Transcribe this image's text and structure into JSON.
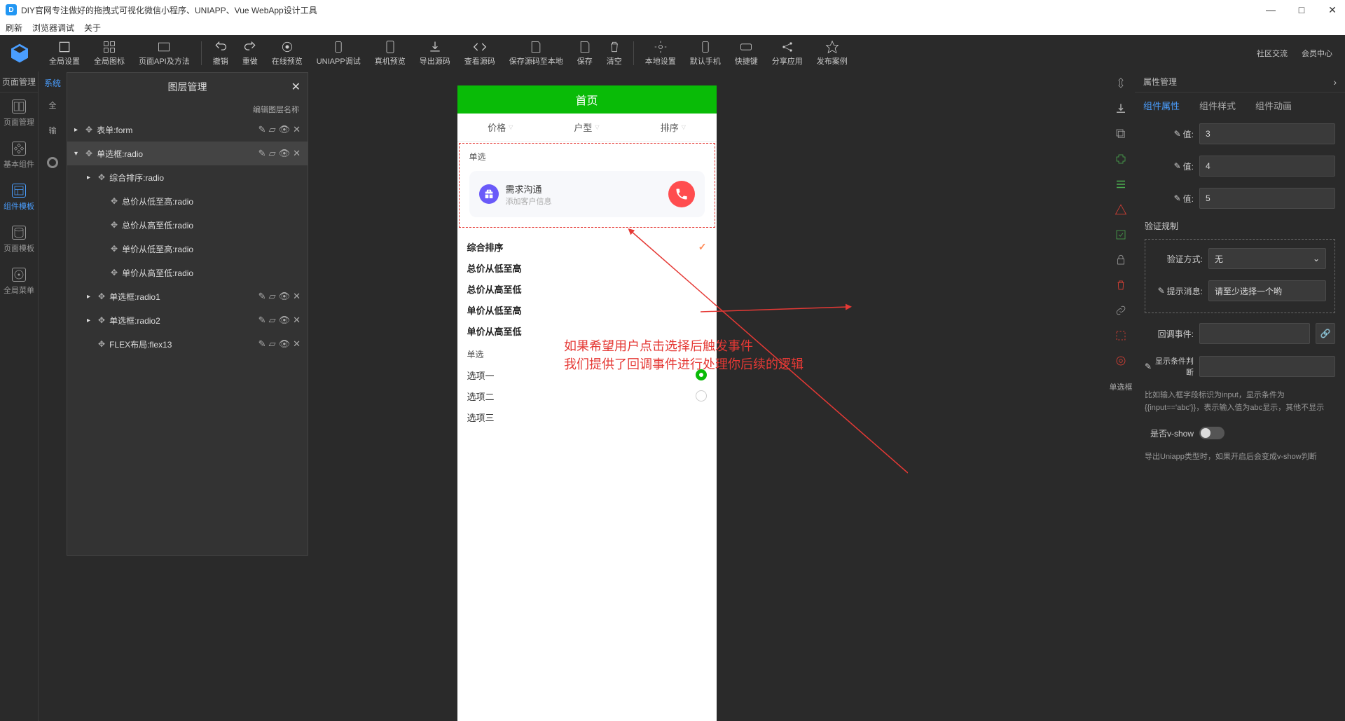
{
  "window": {
    "title": "DIY官网专注做好的拖拽式可视化微信小程序、UNIAPP、Vue WebApp设计工具"
  },
  "menubar": [
    "刷新",
    "浏览器调试",
    "关于"
  ],
  "toolbar": [
    {
      "label": "全局设置"
    },
    {
      "label": "全局图标"
    },
    {
      "label": "页面API及方法"
    },
    {
      "label": "撤销"
    },
    {
      "label": "重做"
    },
    {
      "label": "在线预览"
    },
    {
      "label": "UNIAPP调试"
    },
    {
      "label": "真机预览"
    },
    {
      "label": "导出源码"
    },
    {
      "label": "查看源码"
    },
    {
      "label": "保存源码至本地"
    },
    {
      "label": "保存"
    },
    {
      "label": "清空"
    },
    {
      "label": "本地设置"
    },
    {
      "label": "默认手机"
    },
    {
      "label": "快捷键"
    },
    {
      "label": "分享应用"
    },
    {
      "label": "发布案例"
    },
    {
      "label": "社区交流"
    },
    {
      "label": "会员中心"
    }
  ],
  "leftrail": {
    "pagetab": "页面管理",
    "items": [
      "页面管理",
      "基本组件",
      "组件模板",
      "页面模板",
      "全局菜单"
    ]
  },
  "syslabel": "系统",
  "sysitems": [
    "全",
    "输"
  ],
  "layer": {
    "title": "图层管理",
    "sub": "编辑图层名称",
    "items": [
      {
        "lv": 1,
        "arrow": "▸",
        "name": "表单:form",
        "ops": true
      },
      {
        "lv": 1,
        "arrow": "▾",
        "name": "单选框:radio",
        "ops": true,
        "active": true
      },
      {
        "lv": 2,
        "arrow": "▸",
        "name": "综合排序:radio"
      },
      {
        "lv": 3,
        "arrow": "",
        "name": "总价从低至高:radio"
      },
      {
        "lv": 3,
        "arrow": "",
        "name": "总价从高至低:radio"
      },
      {
        "lv": 3,
        "arrow": "",
        "name": "单价从低至高:radio"
      },
      {
        "lv": 3,
        "arrow": "",
        "name": "单价从高至低:radio"
      },
      {
        "lv": 2,
        "arrow": "▸",
        "name": "单选框:radio1",
        "ops": true
      },
      {
        "lv": 2,
        "arrow": "▸",
        "name": "单选框:radio2",
        "ops": true
      },
      {
        "lv": 2,
        "arrow": "",
        "name": "FLEX布局:flex13",
        "ops": true
      }
    ]
  },
  "phone": {
    "title": "首页",
    "tabs": [
      "价格",
      "户型",
      "排序"
    ],
    "sec1": "单选",
    "card": {
      "t1": "需求沟通",
      "t2": "添加客户信息"
    },
    "sortlist": [
      "综合排序",
      "总价从低至高",
      "总价从高至低",
      "单价从低至高",
      "单价从高至低"
    ],
    "sec2": "单选",
    "opts": [
      "选项一",
      "选项二",
      "选项三"
    ]
  },
  "annotation": {
    "l1": "如果希望用户点击选择后触发事件",
    "l2": "我们提供了回调事件进行处理你后续的逻辑"
  },
  "righthead": "属性管理",
  "proptabs": [
    "组件属性",
    "组件样式",
    "组件动画"
  ],
  "props": {
    "vlabel": "值:",
    "vals": [
      "3",
      "4",
      "5"
    ],
    "validTitle": "验证规制",
    "validMode": {
      "label": "验证方式:",
      "value": "无"
    },
    "hint": {
      "label": "提示消息:",
      "value": "请至少选择一个哟"
    },
    "callback": {
      "label": "回调事件:",
      "value": ""
    },
    "cond": {
      "label": "显示条件判断",
      "value": ""
    },
    "help": "比如输入框字段标识为input，显示条件为{{input=='abc'}}，表示输入值为abc显示，其他不显示",
    "vshow": {
      "label": "是否v-show"
    },
    "vshowHelp": "导出Uniapp类型时，如果开启后会变成v-show判断"
  },
  "iconlabel": "单选框"
}
